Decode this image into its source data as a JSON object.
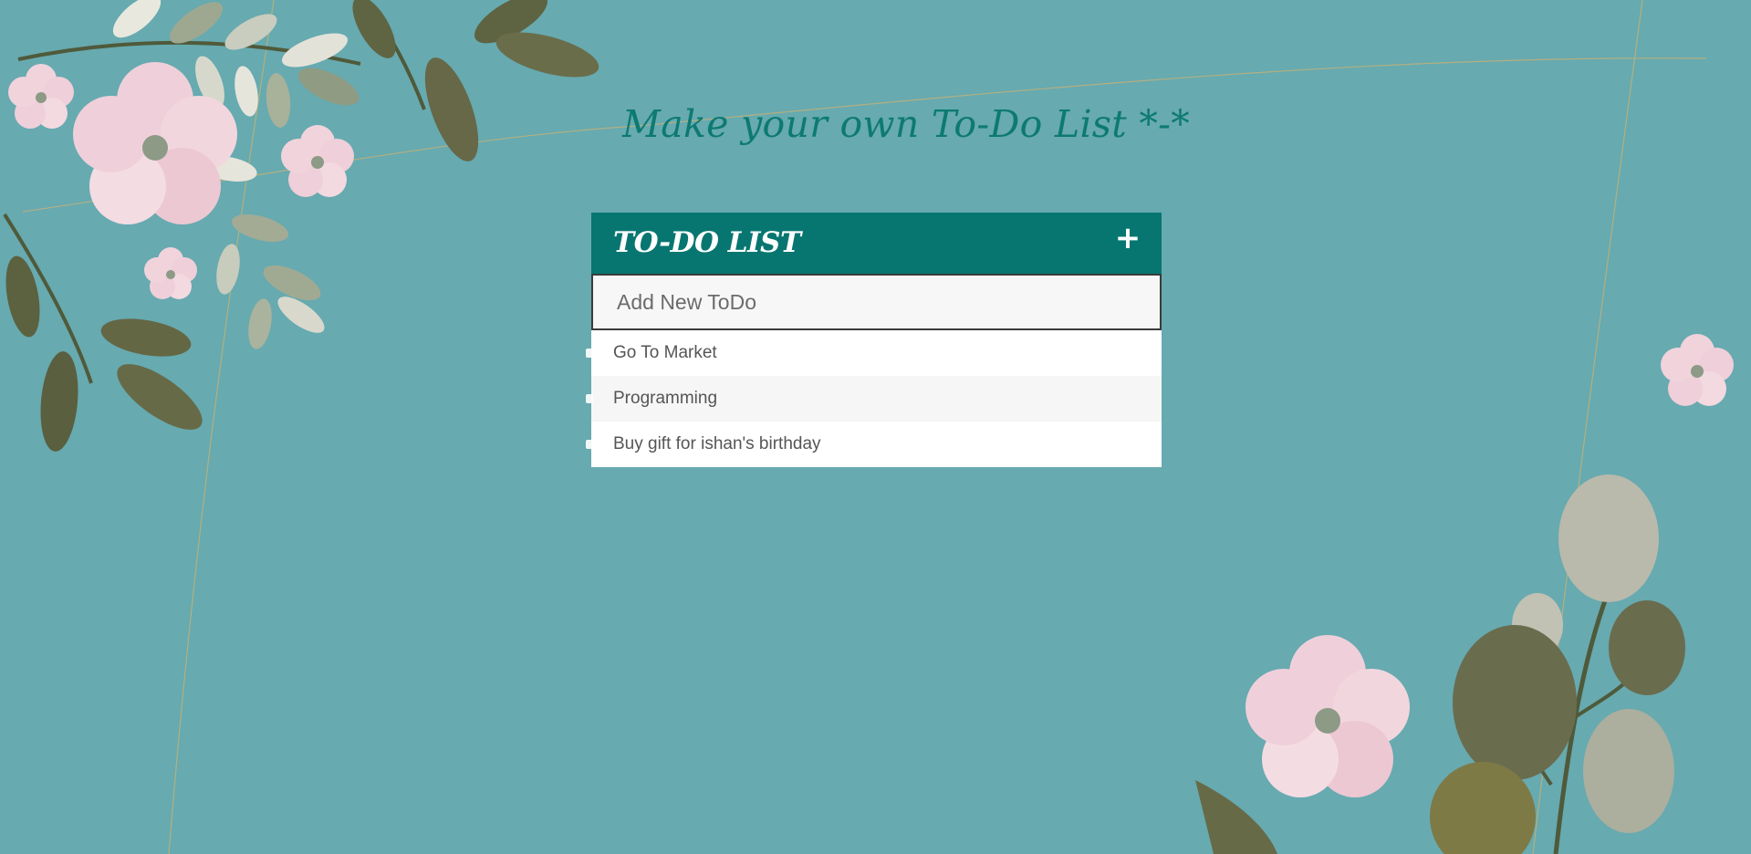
{
  "page": {
    "heading": "Make your own To-Do List *-*"
  },
  "todo_card": {
    "title": "TO-DO LIST",
    "add_icon": "plus-icon",
    "input": {
      "placeholder": "Add New ToDo",
      "value": ""
    },
    "items": [
      {
        "text": "Go To Market"
      },
      {
        "text": "Programming"
      },
      {
        "text": "Buy gift for ishan's birthday"
      }
    ]
  },
  "colors": {
    "background": "#67aab0",
    "accent": "#077670",
    "heading": "#0d7a72",
    "item_text": "#555555"
  }
}
